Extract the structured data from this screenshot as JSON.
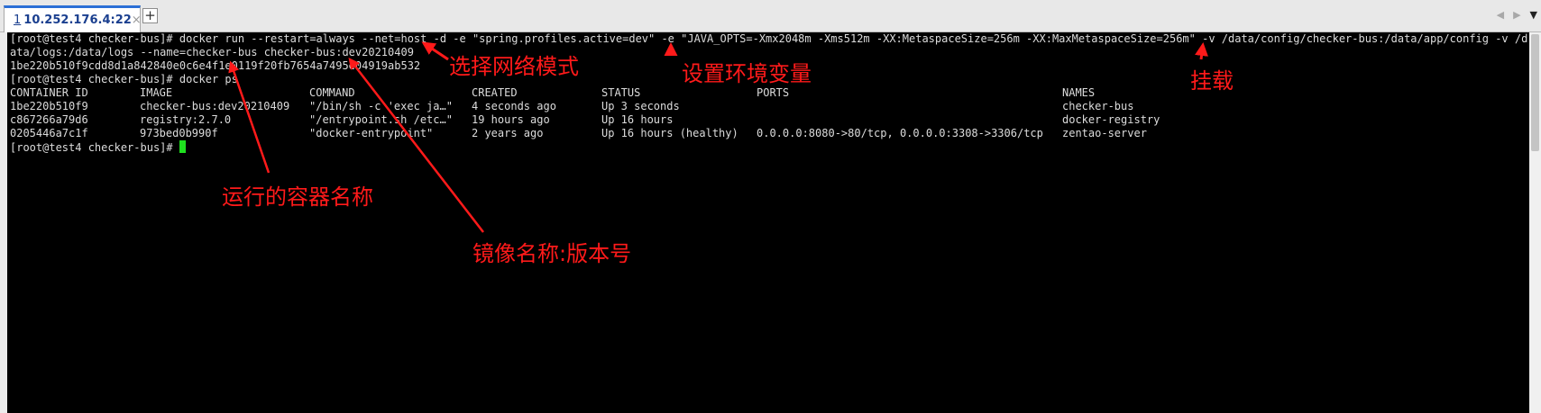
{
  "tab": {
    "number": "1",
    "label": "10.252.176.4:22",
    "close_glyph": "×",
    "add_glyph": "+"
  },
  "nav": {
    "prev": "◀",
    "next": "▶",
    "menu": "▼"
  },
  "terminal": {
    "lines": [
      "[root@test4 checker-bus]# docker run --restart=always --net=host -d -e \"spring.profiles.active=dev\" -e \"JAVA_OPTS=-Xmx2048m -Xms512m -XX:MetaspaceSize=256m -XX:MaxMetaspaceSize=256m\" -v /data/config/checker-bus:/data/app/config -v /d",
      "ata/logs:/data/logs --name=checker-bus checker-bus:dev20210409",
      "1be220b510f9cdd8d1a842840e0c6e4f1e0119f20fb7654a7495e04919ab532",
      "[root@test4 checker-bus]# docker ps"
    ],
    "table": {
      "headers": [
        "CONTAINER ID",
        "IMAGE",
        "COMMAND",
        "CREATED",
        "STATUS",
        "PORTS",
        "NAMES"
      ],
      "rows": [
        [
          "1be220b510f9",
          "checker-bus:dev20210409",
          "\"/bin/sh -c 'exec ja…\"",
          "4 seconds ago",
          "Up 3 seconds",
          "",
          "checker-bus"
        ],
        [
          "c867266a79d6",
          "registry:2.7.0",
          "\"/entrypoint.sh /etc…\"",
          "19 hours ago",
          "Up 16 hours",
          "",
          "docker-registry"
        ],
        [
          "0205446a7c1f",
          "973bed0b990f",
          "\"docker-entrypoint\"",
          "2 years ago",
          "Up 16 hours (healthy)",
          "0.0.0.0:8080->80/tcp, 0.0.0.0:3308->3306/tcp",
          "zentao-server"
        ]
      ]
    },
    "prompt": "[root@test4 checker-bus]# "
  },
  "annotations": {
    "network_mode": "选择网络模式",
    "env_vars": "设置环境变量",
    "mount": "挂载",
    "container_name": "运行的容器名称",
    "image_version": "镜像名称:版本号"
  },
  "colors": {
    "annotation": "#ff1a1a",
    "cursor": "#1fe01f",
    "terminal_bg": "#000000",
    "terminal_fg": "#dcdcdc"
  }
}
